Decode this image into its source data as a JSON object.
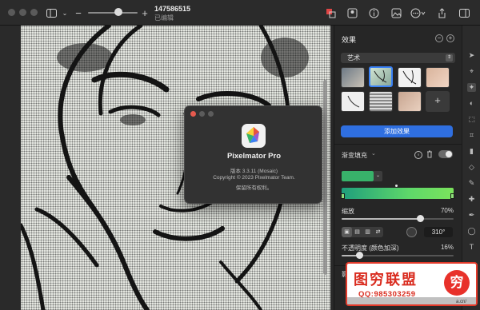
{
  "toolbar": {
    "doc_title": "147586515",
    "doc_subtitle": "已编辑"
  },
  "about": {
    "app_name": "Pixelmator Pro",
    "version": "版本 3.3.11 (Mosaic)",
    "copyright": "Copyright © 2023 Pixelmator Team.",
    "rights": "保留所有权利。"
  },
  "panel": {
    "title": "效果",
    "category": "艺术",
    "add_effect": "添加效果",
    "gradient_fill_label": "渐变填充",
    "scale_label": "缩放",
    "scale_value": "70%",
    "scale_level": 0.7,
    "angle_value": "310°",
    "opacity_label": "不透明度 (颜色加深)",
    "opacity_value": "16%",
    "opacity_level": 0.16,
    "bottom_label": "影修",
    "colors": {
      "accent": "#2f6fe0",
      "swatch": "#38b26a",
      "gradient_start": "#1f9e7c",
      "gradient_end": "#7be35c"
    }
  },
  "watermark": {
    "main": "图穷联盟",
    "sub": "QQ:985303259",
    "logo": "穷",
    "url": "a.cn/"
  }
}
